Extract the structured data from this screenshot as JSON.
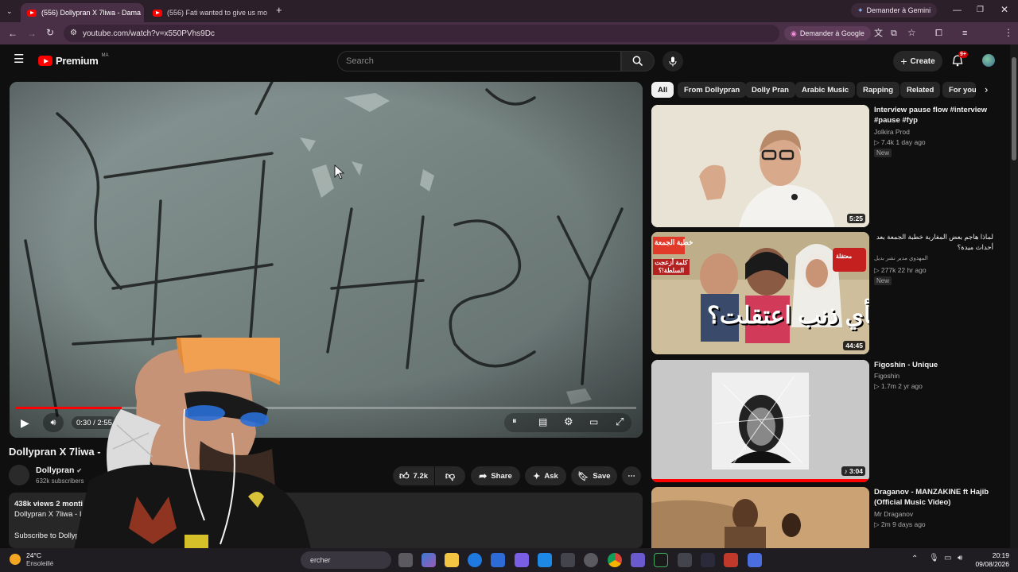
{
  "browser": {
    "tabs": [
      {
        "title": "(556) Dollypran X 7liwa - Dama",
        "active": true
      },
      {
        "title": "(556) Fati wanted to give us mo",
        "active": false
      }
    ],
    "url": "youtube.com/watch?v=x550PVhs9Dc",
    "gemini_label": "Demander à Gemini",
    "google_chip": "Demander à Google"
  },
  "header": {
    "logo_text": "Premium",
    "country_code": "MA",
    "search_placeholder": "Search",
    "create_label": "Create",
    "notif_count": "9+"
  },
  "player": {
    "time": "0:30 / 2:55",
    "progress": 0.17
  },
  "video": {
    "title": "Dollypran X 7liwa -",
    "channel": "Dollypran",
    "subscribers": "632k subscribers",
    "likes": "7.2k",
    "share_label": "Share",
    "ask_label": "Ask",
    "save_label": "Save",
    "views_line": "438k views  2 monti",
    "desc_line": "Dollypran X 7liwa - I",
    "subscribe_line": "Subscribe to Dollyp"
  },
  "filters": [
    "All",
    "From Dollypran",
    "Dolly Pran",
    "Arabic Music",
    "Rapping",
    "Related",
    "For you"
  ],
  "recommendations": [
    {
      "title": "Interview pause flow #interview #pause #fyp",
      "channel": "Jolkira Prod",
      "meta": "▷ 7.4k  1 day ago",
      "badge": "New",
      "duration": "5:25"
    },
    {
      "title": "لماذا هاجم بعض المغاربة خطبة الجمعة بعد أحداث ميدة؟",
      "channel": "المهدوي مدير نشر بديل",
      "meta": "▷ 277k  22 hr ago",
      "badge": "New",
      "duration": "44:45"
    },
    {
      "title": "Figoshin - Unique",
      "channel": "Figoshin",
      "meta": "▷ 1.7m  2 yr ago",
      "badge": "",
      "duration": "3:04"
    },
    {
      "title": "Draganov - MANZAKINE ft Hajib (Official Music Video)",
      "channel": "Mr Draganov",
      "meta": "▷ 2m  9 days ago",
      "badge": "",
      "duration": ""
    }
  ],
  "thumb2_text": {
    "main": "بأي ذنب اعتقلت؟",
    "tag1": "خطبة الجمعة",
    "tag2": "كلمة أزعجت السلطة!؟",
    "tag3": "معتقلة"
  },
  "taskbar": {
    "weather_temp": "24°C",
    "weather_desc": "Ensoleillé",
    "search_text": "ercher",
    "time": "20:19",
    "date": "09/08/2026"
  },
  "colors": {
    "youtube_red": "#ff0000",
    "bg": "#0f0f0f",
    "chip": "#272727"
  }
}
